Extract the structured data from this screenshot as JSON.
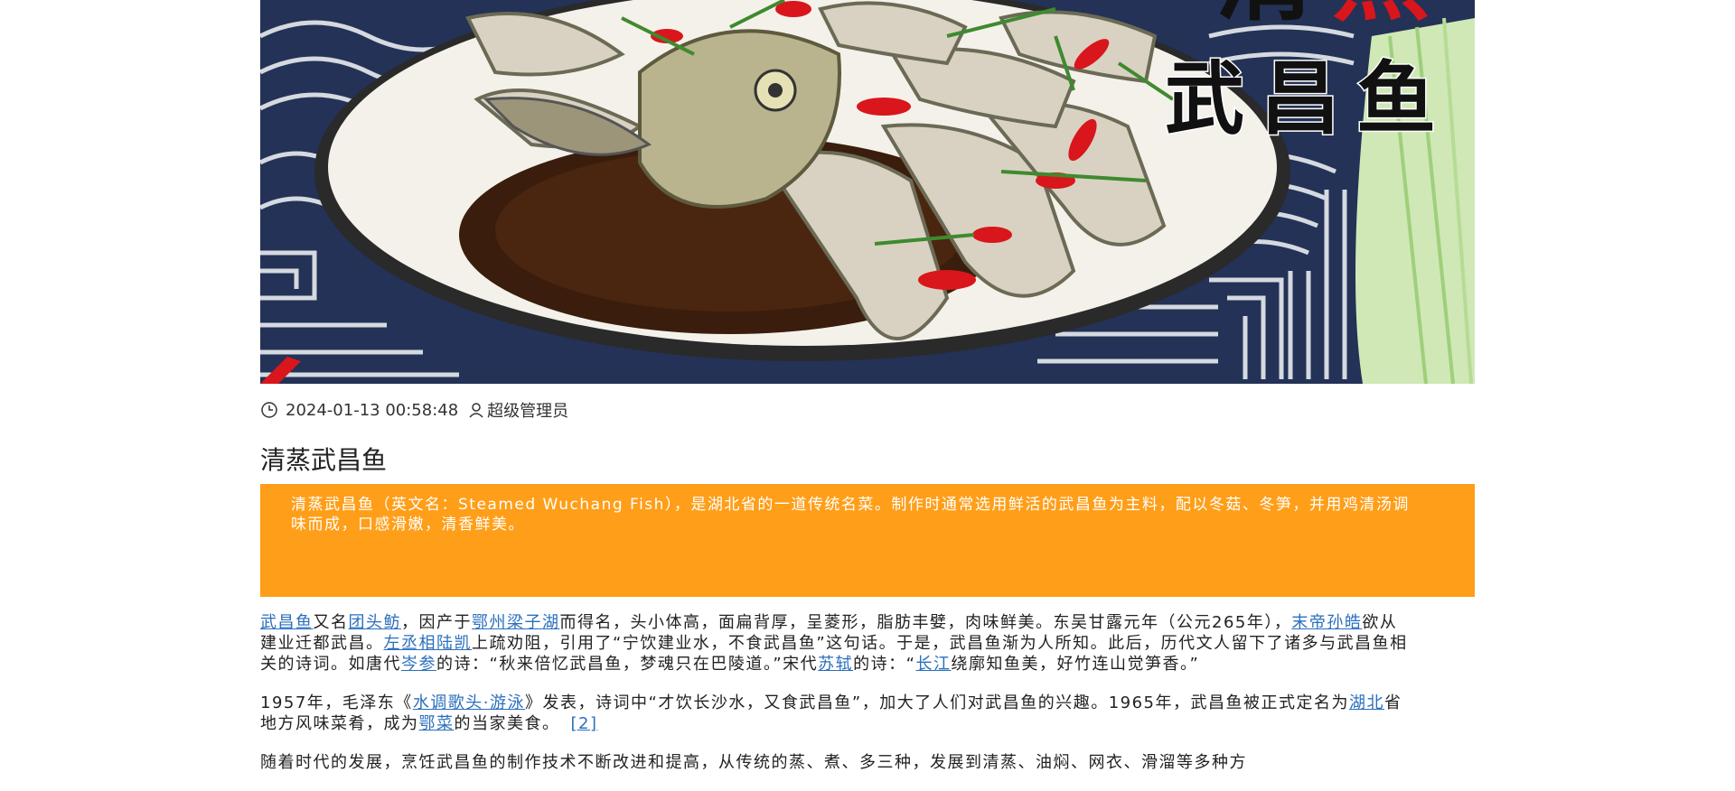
{
  "hero": {
    "overlay_line1_left": "清",
    "overlay_line1_right": "蒸",
    "overlay_line2": "武昌鱼"
  },
  "meta": {
    "clock_icon": "clock-icon",
    "datetime": "2024-01-13 00:58:48",
    "user_icon": "user-icon",
    "author": "超级管理员"
  },
  "article": {
    "title": "清蒸武昌鱼",
    "summary": "清蒸武昌鱼（英文名：Steamed Wuchang Fish），是湖北省的一道传统名菜。制作时通常选用鲜活的武昌鱼为主料，配以冬菇、冬笋，并用鸡清汤调味而成，口感滑嫩，清香鲜美。",
    "p1": {
      "link1": "武昌鱼",
      "t1": "又名",
      "link2": "团头鲂",
      "t2": "，因产于",
      "link3": "鄂州梁子湖",
      "t3": "而得名，头小体高，面扁背厚，呈菱形，脂肪丰嬖，肉味鲜美。东吴甘露元年（公元265年），",
      "link4": "末帝孙皓",
      "t4": "欲从建业迁都武昌。",
      "link5": "左丞相陆凯",
      "t5": "上疏劝阻，引用了“宁饮建业水，不食武昌鱼”这句话。于是，武昌鱼渐为人所知。此后，历代文人留下了诸多与武昌鱼相关的诗词。如唐代",
      "link6": "岑参",
      "t6": "的诗：“秋来倍忆武昌鱼，梦魂只在巴陵道。”宋代",
      "link7": "苏轼",
      "t7": "的诗：“",
      "link8": "长江",
      "t8": "绕廓知鱼美，好竹连山觉笋香。”"
    },
    "p2": {
      "t1": "1957年，毛泽东《",
      "link1": "水调歌头·游泳",
      "t2": "》发表，诗词中“才饮长沙水，又食武昌鱼”，加大了人们对武昌鱼的兴趣。1965年，武昌鱼被正式定名为",
      "link2": "湖北",
      "t3": "省地方风味菜肴，成为",
      "link3": "鄂菜",
      "t4": "的当家美食。",
      "ref": "[2]"
    },
    "p3": {
      "t1": "随着时代的发展，烹饪武昌鱼的制作技术不断改进和提高，从传统的蒸、煮、多三种，发展到清蒸、油焖、网衣、滑溜等多种方"
    }
  }
}
